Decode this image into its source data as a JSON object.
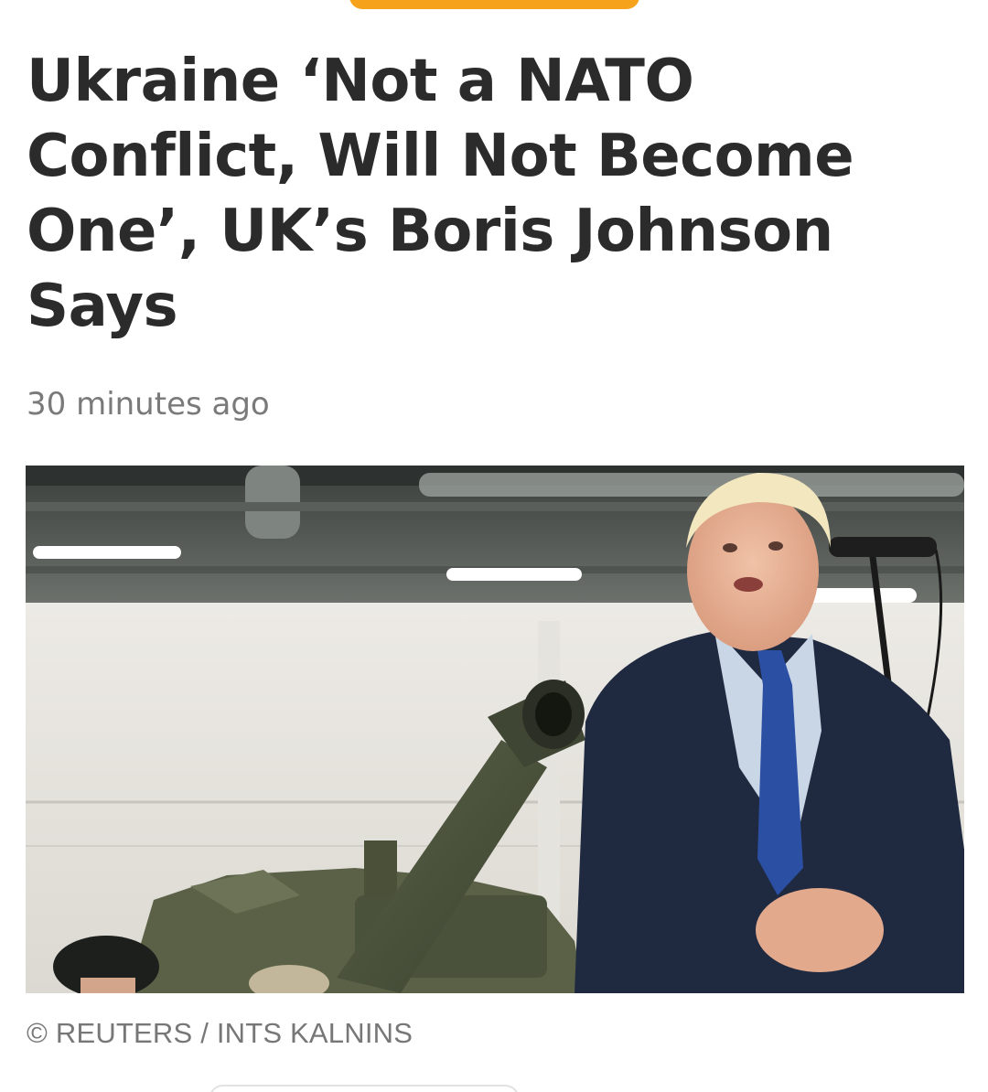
{
  "article": {
    "headline": "Ukraine ‘Not a NATO Conflict, Will Not Become One’, UK’s Boris Johnson Says",
    "timestamp": "30 minutes ago",
    "photo_credit": "© REUTERS / INTS KALNINS"
  },
  "colors": {
    "accent": "#f7a21b",
    "headline_text": "#2b2b2b",
    "meta_text": "#7a7a7a"
  }
}
